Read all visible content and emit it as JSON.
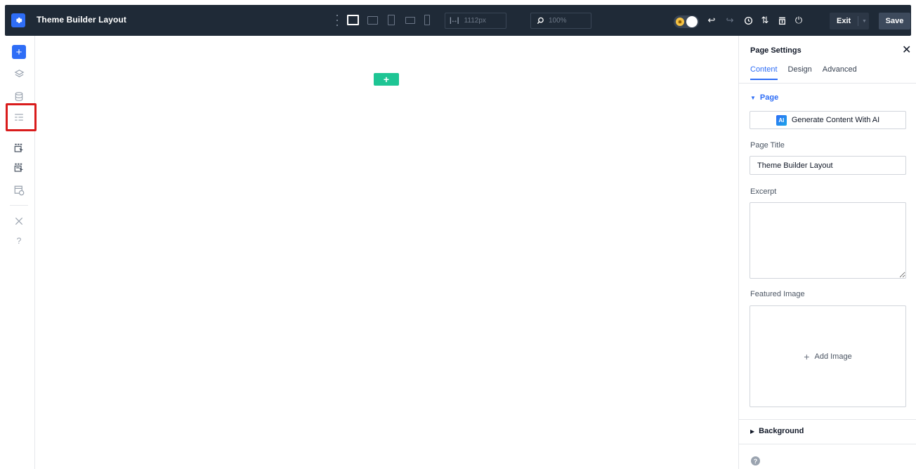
{
  "topbar": {
    "title": "Theme Builder Layout",
    "width_value": "1112px",
    "zoom_value": "100%",
    "exit_label": "Exit",
    "save_label": "Save"
  },
  "canvas": {
    "add_symbol": "+"
  },
  "panel": {
    "title": "Page Settings",
    "tabs": [
      {
        "label": "Content",
        "active": true
      },
      {
        "label": "Design",
        "active": false
      },
      {
        "label": "Advanced",
        "active": false
      }
    ],
    "page_section": {
      "label": "Page",
      "ai_badge": "AI",
      "ai_button": "Generate Content With AI",
      "title_label": "Page Title",
      "title_value": "Theme Builder Layout",
      "excerpt_label": "Excerpt",
      "excerpt_value": "",
      "featured_label": "Featured Image",
      "add_image": "Add Image"
    },
    "background_section": {
      "label": "Background"
    }
  },
  "colors": {
    "accent": "#2e6df6",
    "topbar_bg": "#1f2a37",
    "canvas_add": "#1ec594",
    "highlight": "#d91c1c"
  }
}
